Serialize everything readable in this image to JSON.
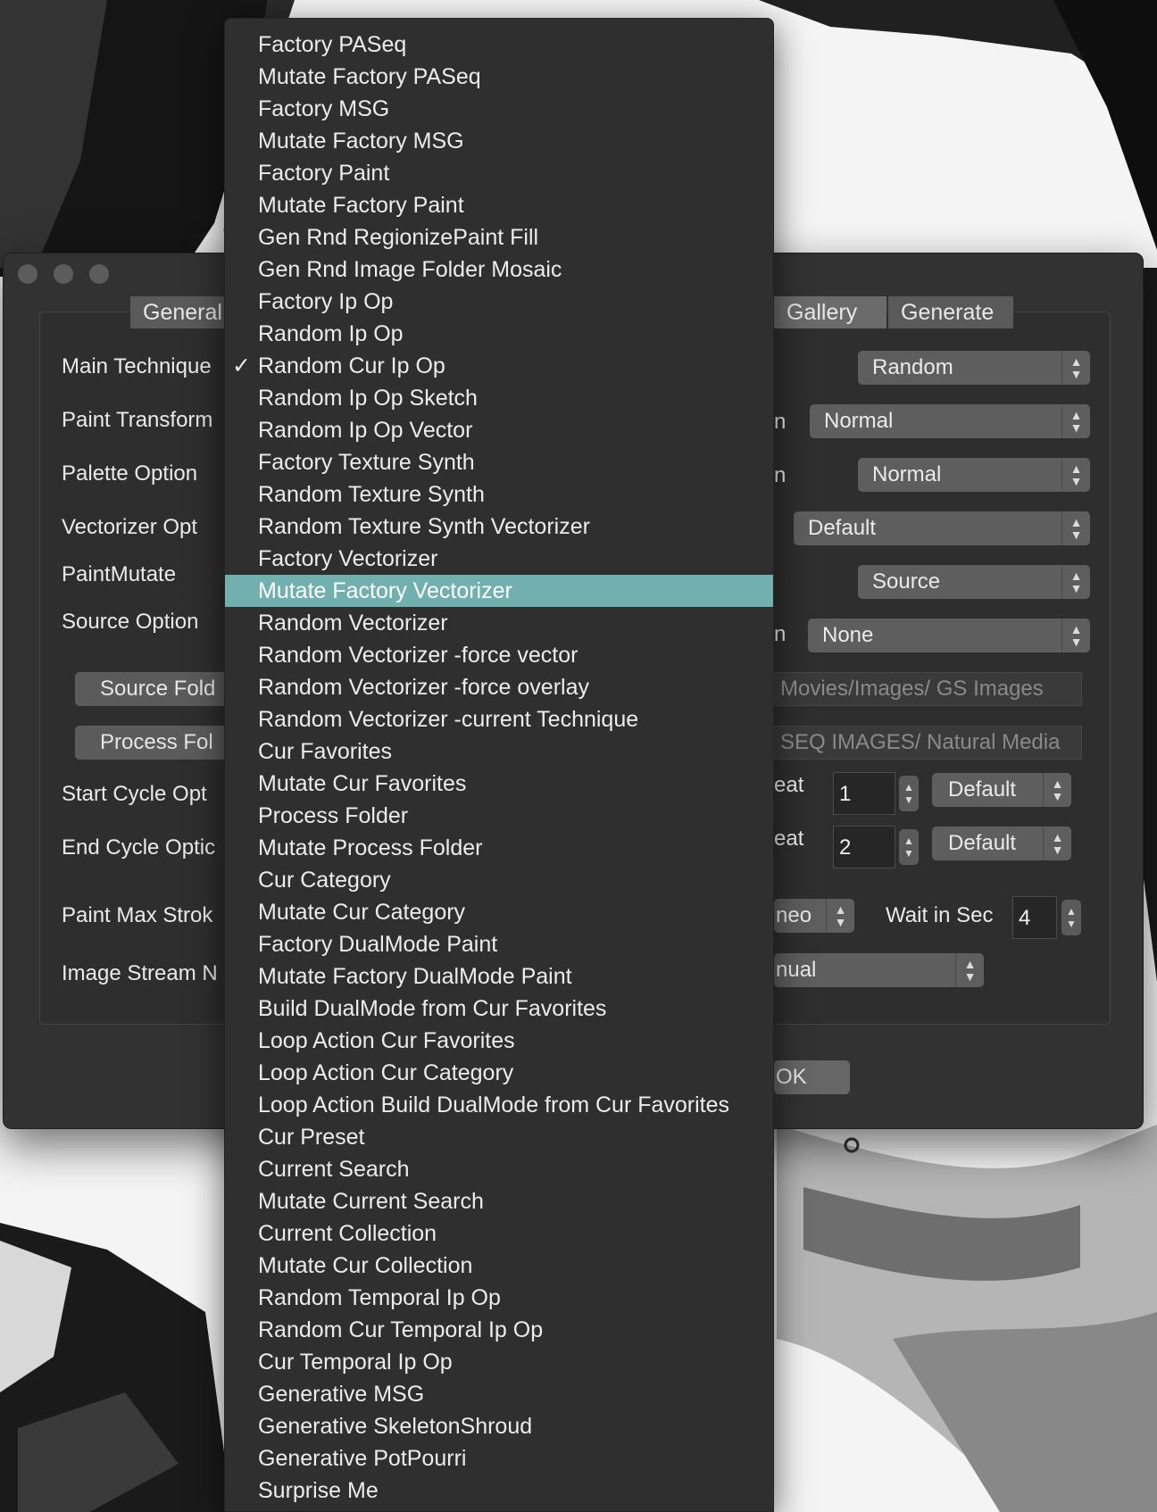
{
  "dialog": {
    "tabs": [
      {
        "label": "General"
      },
      {
        "label": "Gallery"
      },
      {
        "label": "Generate"
      }
    ],
    "left_labels": [
      "Main Technique",
      "Paint Transform",
      "Palette Option",
      "Vectorizer Opt",
      "PaintMutate",
      "Source Option",
      "Start Cycle Opt",
      "End Cycle Optic",
      "Paint Max Strok",
      "Image Stream N"
    ],
    "left_buttons": [
      {
        "label": "Source Fold"
      },
      {
        "label": "Process Fol"
      }
    ],
    "right_label_fragments": [
      "n",
      "n",
      "n",
      "eat",
      "eat"
    ],
    "right_popups": [
      {
        "value": "Random"
      },
      {
        "value": "Normal"
      },
      {
        "value": "Normal"
      },
      {
        "value": "Default"
      },
      {
        "value": "Source"
      },
      {
        "value": "None"
      }
    ],
    "paths": [
      {
        "value": "Movies/Images/  GS Images"
      },
      {
        "value": "SEQ IMAGES/  Natural Media"
      }
    ],
    "repeat_rows": [
      {
        "number": "1",
        "option": "Default"
      },
      {
        "number": "2",
        "option": "Default"
      }
    ],
    "partial_popup_1": "neo",
    "wait_label": "Wait in Sec",
    "wait_value": "4",
    "partial_popup_2": "nual",
    "ok_label": "OK"
  },
  "menu": {
    "checked_index": 10,
    "highlighted_index": 17,
    "check_glyph": "✓",
    "items": [
      "Factory PASeq",
      "Mutate Factory PASeq",
      "Factory MSG",
      "Mutate Factory MSG",
      "Factory Paint",
      "Mutate Factory Paint",
      "Gen Rnd RegionizePaint Fill",
      "Gen Rnd Image Folder Mosaic",
      "Factory Ip Op",
      "Random Ip Op",
      "Random Cur Ip Op",
      "Random Ip Op Sketch",
      "Random Ip Op Vector",
      "Factory Texture Synth",
      "Random Texture Synth",
      "Random Texture Synth Vectorizer",
      "Factory Vectorizer",
      "Mutate Factory Vectorizer",
      "Random Vectorizer",
      "Random Vectorizer -force vector",
      "Random Vectorizer -force overlay",
      "Random Vectorizer -current Technique",
      "Cur Favorites",
      "Mutate Cur Favorites",
      "Process Folder",
      "Mutate Process Folder",
      "Cur Category",
      "Mutate Cur Category",
      "Factory DualMode Paint",
      "Mutate Factory DualMode Paint",
      "Build DualMode from Cur Favorites",
      "Loop Action Cur Favorites",
      "Loop Action Cur Category",
      "Loop Action Build DualMode from Cur Favorites",
      "Cur Preset",
      "Current Search",
      "Mutate Current Search",
      "Current Collection",
      "Mutate Cur Collection",
      "Random Temporal Ip Op",
      "Random Cur Temporal Ip Op",
      "Cur Temporal Ip Op",
      "Generative MSG",
      "Generative SkeletonShroud",
      "Generative PotPourri",
      "Surprise Me"
    ]
  },
  "icons": {
    "popup_arrows": "updown-chevrons-icon",
    "stepper": "stepper-icon",
    "checkmark": "checkmark-icon"
  },
  "colors": {
    "highlight": "#72b0b0",
    "window_bg": "#323232",
    "menu_bg": "#2f2f2f"
  }
}
